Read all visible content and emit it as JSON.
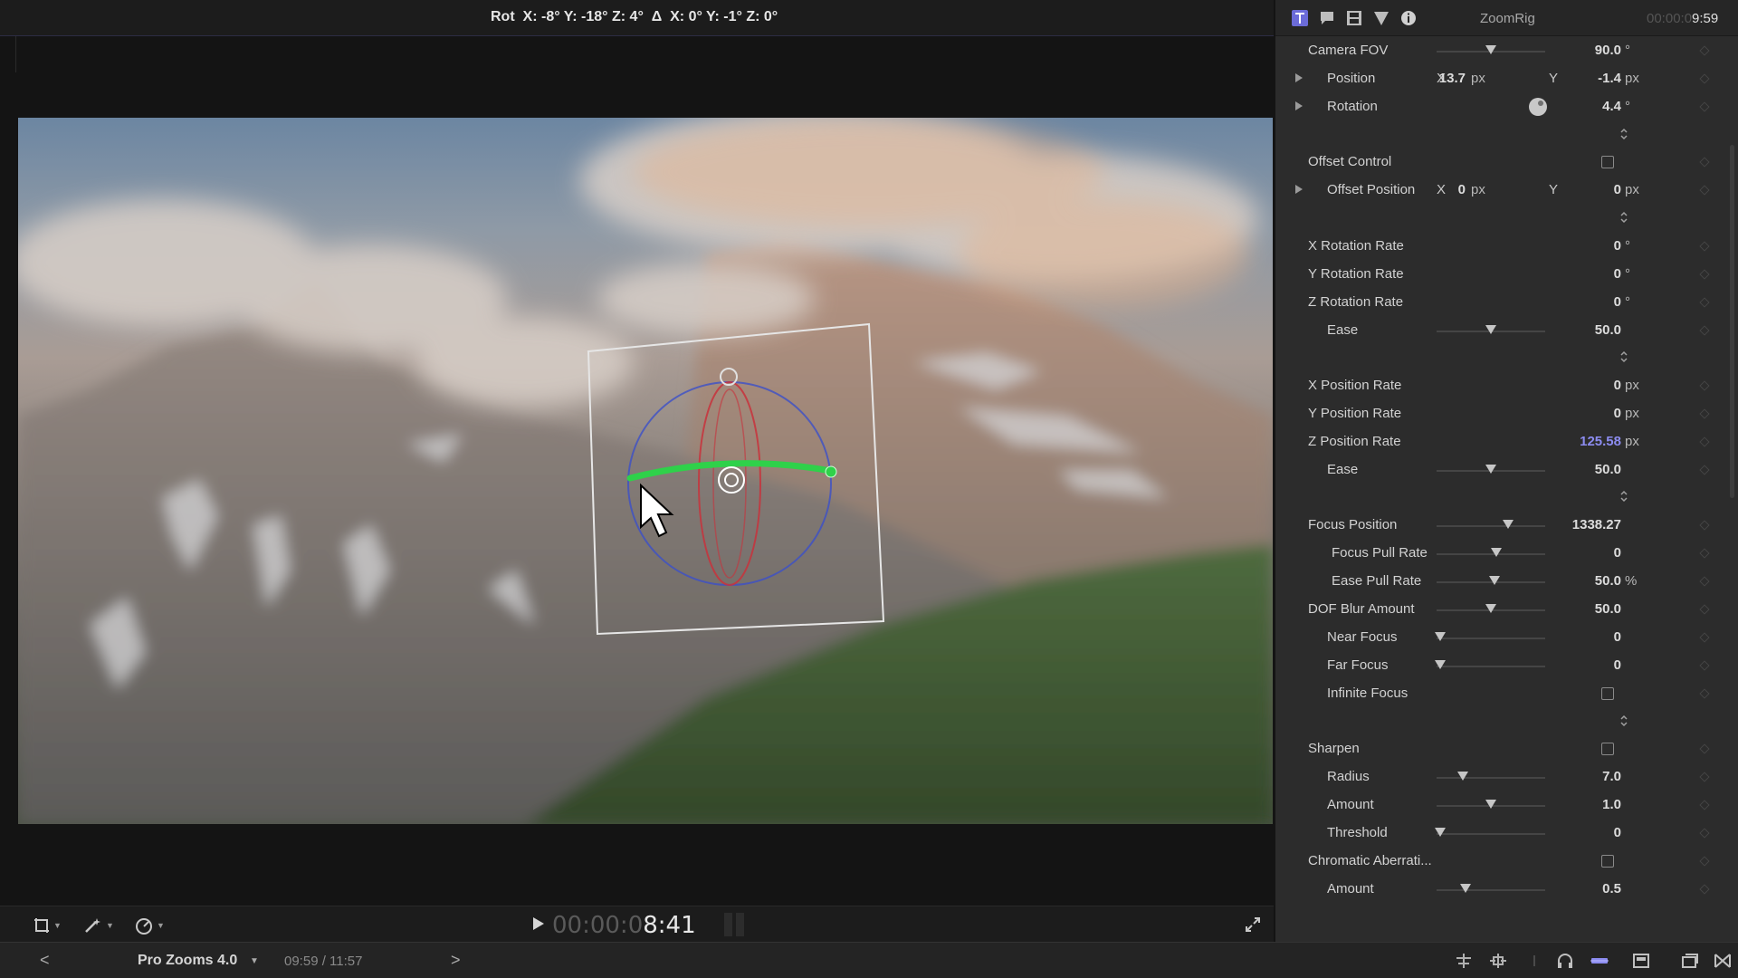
{
  "viewer": {
    "hud_readout": "Rot  X: -8° Y: -18° Z: 4°  Δ  X: 0° Y: -1° Z: 0°",
    "timecode_dim": "00:00:0",
    "timecode_bright": "8:41"
  },
  "statusbar": {
    "back": "<",
    "project_name": "Pro Zooms 4.0",
    "duration": "09:59 / 11:57",
    "forward": ">"
  },
  "inspector": {
    "title": "ZoomRig",
    "clock_dim": "00:00:0",
    "clock_bright": "9:59",
    "rows": {
      "camera_fov": {
        "label": "Camera FOV",
        "value": "90.0",
        "unit": "°",
        "slider": 0.5
      },
      "position": {
        "label": "Position",
        "x_label": "X",
        "x_value": "13.7",
        "x_unit": "px",
        "y_label": "Y",
        "y_value": "-1.4",
        "y_unit": "px"
      },
      "rotation": {
        "label": "Rotation",
        "value": "4.4",
        "unit": "°"
      },
      "offset_control": {
        "label": "Offset Control",
        "checked": false
      },
      "offset_position": {
        "label": "Offset Position",
        "x_label": "X",
        "x_value": "0",
        "x_unit": "px",
        "y_label": "Y",
        "y_value": "0",
        "y_unit": "px"
      },
      "x_rotation_rate": {
        "label": "X Rotation Rate",
        "value": "0",
        "unit": "°"
      },
      "y_rotation_rate": {
        "label": "Y Rotation Rate",
        "value": "0",
        "unit": "°"
      },
      "z_rotation_rate": {
        "label": "Z Rotation Rate",
        "value": "0",
        "unit": "°"
      },
      "ease_1": {
        "label": "Ease",
        "value": "50.0",
        "slider": 0.5
      },
      "x_position_rate": {
        "label": "X Position Rate",
        "value": "0",
        "unit": "px"
      },
      "y_position_rate": {
        "label": "Y Position Rate",
        "value": "0",
        "unit": "px"
      },
      "z_position_rate": {
        "label": "Z Position Rate",
        "value": "125.58",
        "unit": "px"
      },
      "ease_2": {
        "label": "Ease",
        "value": "50.0",
        "slider": 0.5
      },
      "focus_position": {
        "label": "Focus Position",
        "value": "1338.27",
        "slider": 0.66
      },
      "focus_pull_rate": {
        "label": "Focus Pull Rate",
        "value": "0",
        "slider": 0.55
      },
      "ease_pull_rate": {
        "label": "Ease Pull Rate",
        "value": "50.0",
        "unit": "%",
        "slider": 0.53
      },
      "dof_blur_amount": {
        "label": "DOF Blur Amount",
        "value": "50.0",
        "slider": 0.5
      },
      "near_focus": {
        "label": "Near Focus",
        "value": "0",
        "slider": 0.03
      },
      "far_focus": {
        "label": "Far Focus",
        "value": "0",
        "slider": 0.03
      },
      "infinite_focus": {
        "label": "Infinite Focus",
        "checked": false
      },
      "sharpen": {
        "label": "Sharpen",
        "checked": false
      },
      "radius": {
        "label": "Radius",
        "value": "7.0",
        "slider": 0.24
      },
      "amount_1": {
        "label": "Amount",
        "value": "1.0",
        "slider": 0.5
      },
      "threshold": {
        "label": "Threshold",
        "value": "0",
        "slider": 0.03
      },
      "chromatic_aberration": {
        "label": "Chromatic Aberrati...",
        "checked": false
      },
      "amount_2": {
        "label": "Amount",
        "value": "0.5",
        "slider": 0.27
      }
    }
  },
  "colors": {
    "accent": "#8c8cf0",
    "gizmo_green": "#2fd14a",
    "gizmo_red": "#c8323c",
    "gizmo_blue": "#3c50c8"
  }
}
